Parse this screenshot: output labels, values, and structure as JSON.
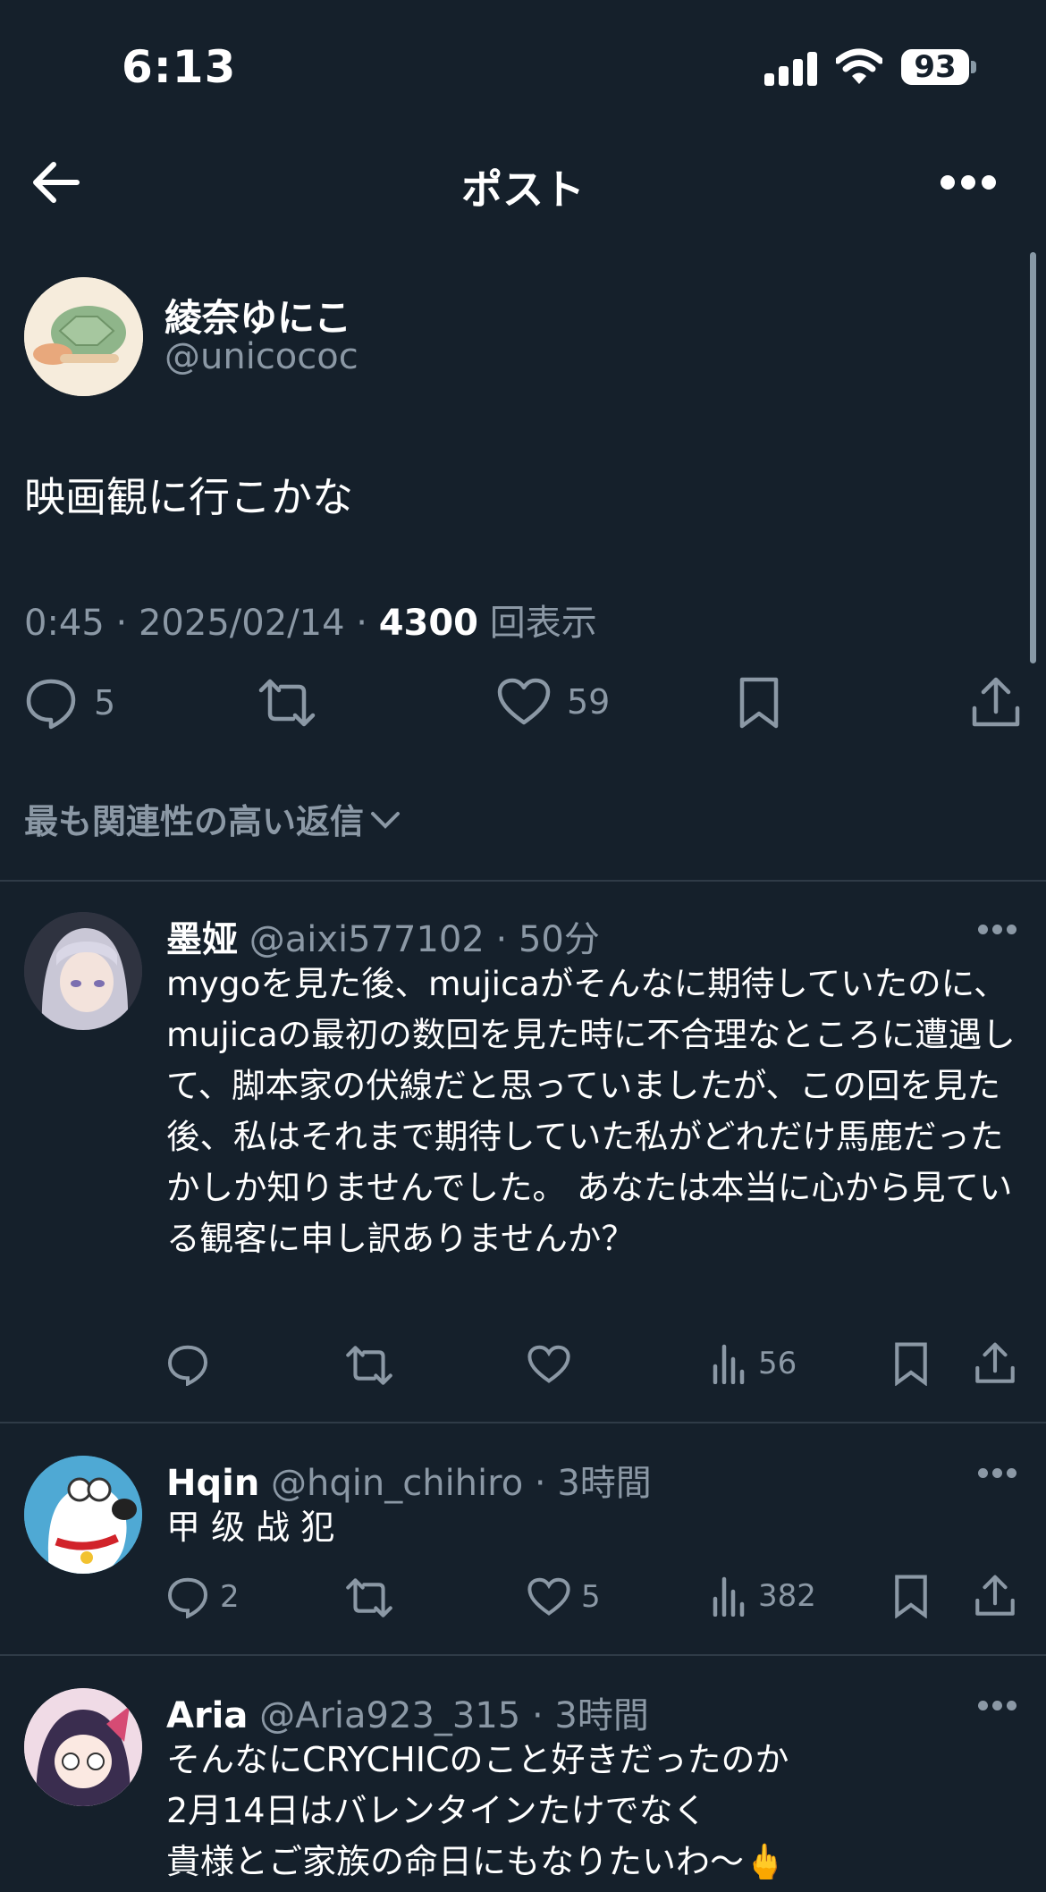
{
  "status_bar": {
    "time": "6:13",
    "battery": "93"
  },
  "header": {
    "title": "ポスト"
  },
  "main_post": {
    "name": "綾奈ゆにこ",
    "handle": "@unicococ",
    "text": "映画観に行こかな",
    "time": "0:45",
    "date": "2025/02/14",
    "views": "4300",
    "views_label": "回表示",
    "replies": "5",
    "likes": "59"
  },
  "replies_sort_label": "最も関連性の高い返信",
  "replies": [
    {
      "name": "墨娅",
      "handle": "@aixi577102",
      "time": "50分",
      "text": "mygoを見た後、mujicaがそんなに期待していたのに、mujicaの最初の数回を見た時に不合理なところに遭遇して、脚本家の伏線だと思っていましたが、この回を見た後、私はそれまで期待していた私がどれだけ馬鹿だったかしか知りませんでした。 あなたは本当に心から見ている観客に申し訳ありませんか？",
      "views": "56"
    },
    {
      "name": "Hqin",
      "handle": "@hqin_chihiro",
      "time": "3時間",
      "text": "甲 级 战 犯",
      "replies": "2",
      "likes": "5",
      "views": "382"
    },
    {
      "name": "Aria",
      "handle": "@Aria923_315",
      "time": "3時間",
      "text_lines": [
        "そんなにCRYCHICのこと好きだったのか",
        "2月14日はバレンタインたけでなく",
        "貴様とご家族の命日にもなりたいわ〜🖕"
      ]
    }
  ]
}
